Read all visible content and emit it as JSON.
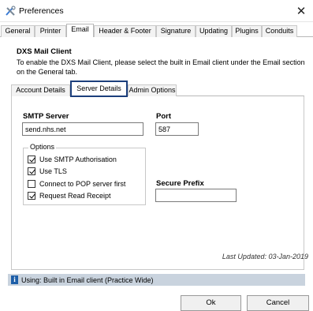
{
  "window": {
    "title": "Preferences",
    "close_glyph": "✕"
  },
  "top_tabs": [
    {
      "label": "General"
    },
    {
      "label": "Printer"
    },
    {
      "label": "Email"
    },
    {
      "label": "Header & Footer"
    },
    {
      "label": "Signature"
    },
    {
      "label": "Updating"
    },
    {
      "label": "Plugins"
    },
    {
      "label": "Conduits"
    }
  ],
  "active_top_tab": "Email",
  "email": {
    "heading": "DXS Mail Client",
    "description": "To enable the DXS Mail Client, please select the built in Email client under the Email section on the General tab.",
    "inner_tabs": [
      {
        "label": "Account Details"
      },
      {
        "label": "Server Details"
      },
      {
        "label": "Admin Options"
      }
    ],
    "active_inner_tab": "Server Details",
    "server": {
      "smtp_label": "SMTP Server",
      "smtp_value": "send.nhs.net",
      "port_label": "Port",
      "port_value": "587",
      "options_label": "Options",
      "options": [
        {
          "label": "Use SMTP Authorisation",
          "checked": true
        },
        {
          "label": "Use TLS",
          "checked": true
        },
        {
          "label": "Connect to POP server first",
          "checked": false
        },
        {
          "label": "Request Read Receipt",
          "checked": true
        }
      ],
      "secure_prefix_label": "Secure Prefix",
      "secure_prefix_value": ""
    },
    "last_updated": "Last Updated: 03-Jan-2019"
  },
  "status": {
    "icon": "info-icon",
    "icon_glyph": "i",
    "text": "Using: Built in Email client (Practice Wide)"
  },
  "buttons": {
    "ok": "Ok",
    "cancel": "Cancel"
  },
  "colors": {
    "accent_border": "#1c3f7c",
    "status_bg": "#c9d3de",
    "info_icon": "#1d5ea8"
  }
}
